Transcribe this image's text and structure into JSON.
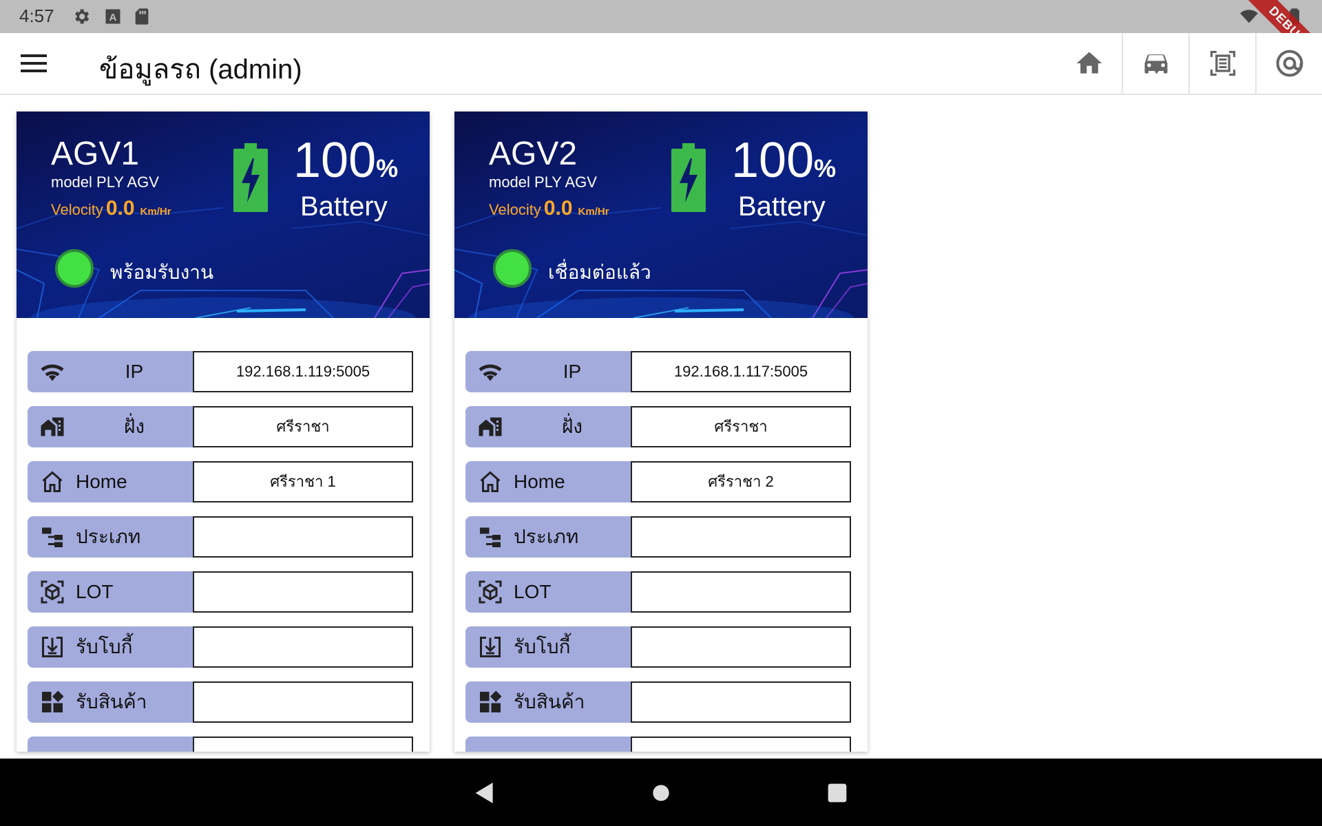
{
  "status_bar": {
    "time": "4:57",
    "icons": [
      "settings-icon",
      "a-notification-icon",
      "sd-card-icon",
      "wifi-off-icon",
      "battery-icon"
    ],
    "debug_banner": "DEBUG"
  },
  "app_bar": {
    "title": "ข้อมูลรถ (admin)",
    "actions": [
      "home-icon",
      "car-icon",
      "document-scan-icon",
      "at-target-icon"
    ]
  },
  "agvs": [
    {
      "name": "AGV1",
      "model": "model PLY AGV",
      "velocity_label": "Velocity",
      "velocity": "0.0",
      "velocity_unit": "Km/Hr",
      "battery_value": "100",
      "battery_percent": "%",
      "battery_label": "Battery",
      "status": "พร้อมรับงาน",
      "status_color": "#43e043",
      "fields": [
        {
          "icon": "wifi-icon",
          "label": "IP",
          "value": "192.168.1.119:5005"
        },
        {
          "icon": "building-icon",
          "label": "ฝั่ง",
          "value": "ศรีราชา"
        },
        {
          "icon": "home-outline-icon",
          "label": "Home",
          "value": "ศรีราชา 1"
        },
        {
          "icon": "hierarchy-icon",
          "label": "ประเภท",
          "value": ""
        },
        {
          "icon": "box-scan-icon",
          "label": "LOT",
          "value": ""
        },
        {
          "icon": "download-box-icon",
          "label": "รับโบกี้",
          "value": ""
        },
        {
          "icon": "widgets-icon",
          "label": "รับสินค้า",
          "value": ""
        }
      ]
    },
    {
      "name": "AGV2",
      "model": "model PLY AGV",
      "velocity_label": "Velocity",
      "velocity": "0.0",
      "velocity_unit": "Km/Hr",
      "battery_value": "100",
      "battery_percent": "%",
      "battery_label": "Battery",
      "status": "เชื่อมต่อแล้ว",
      "status_color": "#43e043",
      "fields": [
        {
          "icon": "wifi-icon",
          "label": "IP",
          "value": "192.168.1.117:5005"
        },
        {
          "icon": "building-icon",
          "label": "ฝั่ง",
          "value": "ศรีราชา"
        },
        {
          "icon": "home-outline-icon",
          "label": "Home",
          "value": "ศรีราชา 2"
        },
        {
          "icon": "hierarchy-icon",
          "label": "ประเภท",
          "value": ""
        },
        {
          "icon": "box-scan-icon",
          "label": "LOT",
          "value": ""
        },
        {
          "icon": "download-box-icon",
          "label": "รับโบกี้",
          "value": ""
        },
        {
          "icon": "widgets-icon",
          "label": "รับสินค้า",
          "value": ""
        }
      ]
    }
  ],
  "nav_bar": {
    "buttons": [
      "back-icon",
      "home-circle-icon",
      "recents-icon"
    ]
  },
  "colors": {
    "label_bg": "#a3abdd",
    "velocity": "#ffa726",
    "battery": "#3cb94a",
    "card_header": "#0a1a6a"
  }
}
